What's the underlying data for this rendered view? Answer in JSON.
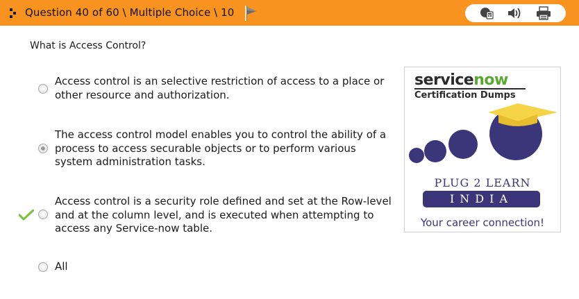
{
  "header": {
    "question_label": "Question 40 of 60 \\ Multiple Choice \\ 10",
    "icons": [
      "drag-handle-icon",
      "flag-icon",
      "calculator-icon",
      "speaker-icon",
      "printer-icon"
    ]
  },
  "question": {
    "text": "What is Access Control?"
  },
  "options": [
    {
      "text": "Access control is an selective restriction of access to a place or other resource and authorization.",
      "selected": false,
      "correct": false
    },
    {
      "text": "The access control model enables you to control the ability of a process to access securable objects or to perform various system administration tasks.",
      "selected": true,
      "correct": false
    },
    {
      "text": "Access control is a security role defined and set at the Row-level and at the column level, and is executed when attempting to access any Service-now table.",
      "selected": false,
      "correct": true
    },
    {
      "text": "All",
      "selected": false,
      "correct": false
    }
  ],
  "logo": {
    "brand_service": "service",
    "brand_now": "now",
    "subtitle": "Certification Dumps",
    "plug_text": "PLUG 2 LEARN",
    "india_text": "INDIA",
    "tagline": "Your career connection!"
  },
  "colors": {
    "header_bg": "#f7931e",
    "check_green": "#7cc242",
    "logo_purple": "#3b357a",
    "logo_yellow": "#f5d447"
  }
}
